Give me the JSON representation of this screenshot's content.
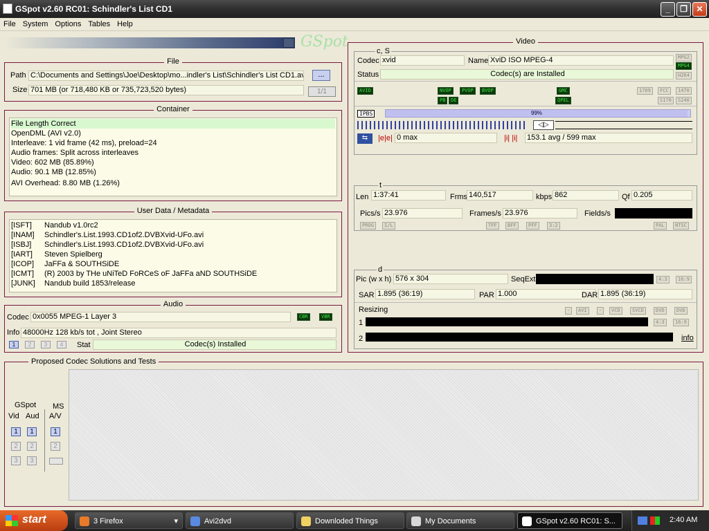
{
  "window": {
    "title": "GSpot v2.60 RC01: Schindler's List CD1"
  },
  "menu": [
    "File",
    "System",
    "Options",
    "Tables",
    "Help"
  ],
  "file": {
    "title": "File",
    "path_label": "Path",
    "path_value": "C:\\Documents and Settings\\Joe\\Desktop\\mo...indler's List\\Schindler's List CD1.avi",
    "browse_label": "...",
    "size_label": "Size",
    "size_value": "701 MB (or 718,480 KB or 735,723,520 bytes)",
    "page_counter": "1/1"
  },
  "container": {
    "title": "Container",
    "lines": [
      "File Length Correct",
      "OpenDML (AVI v2.0)",
      "Interleave: 1 vid frame (42 ms), preload=24",
      "Audio frames: Split across interleaves",
      "Video: 602 MB (85.89%)",
      "Audio: 90.1 MB (12.85%)",
      "AVI Overhead: 8.80 MB (1.26%)"
    ]
  },
  "userdata": {
    "title": "User Data / Metadata",
    "rows": [
      {
        "key": "[ISFT]",
        "val": "Nandub v1.0rc2"
      },
      {
        "key": "[INAM]",
        "val": "Schindler's.List.1993.CD1of2.DVBXvid-UFo.avi"
      },
      {
        "key": "[ISBJ]",
        "val": "Schindler's.List.1993.CD1of2.DVBXvid-UFo.avi"
      },
      {
        "key": "[IART]",
        "val": "Steven Spielberg"
      },
      {
        "key": "[ICOP]",
        "val": "JaFFa & SOUTHSiDE"
      },
      {
        "key": "[ICMT]",
        "val": "(R) 2003 by THe uNiTeD FoRCeS oF JaFFa aND SOUTHSiDE"
      },
      {
        "key": "[JUNK]",
        "val": "Nandub build 1853/release"
      }
    ]
  },
  "audio": {
    "title": "Audio",
    "codec_label": "Codec",
    "codec_value": "0x0055  MPEG-1 Layer 3",
    "cbr": "CBR",
    "vbr": "VBR",
    "info_label": "Info",
    "info_value": "48000Hz  128 kb/s tot , Joint Stereo",
    "stat_label": "Stat",
    "stat_value": "Codec(s) Installed",
    "tracks": [
      "1",
      "2",
      "3",
      "4"
    ]
  },
  "video": {
    "title": "Video",
    "cs_title": "c, S",
    "codec_label": "Codec",
    "codec_value": "xvid",
    "name_label": "Name",
    "name_value": "XviD ISO MPEG-4",
    "status_label": "Status",
    "status_value": "Codec(s) are Installed",
    "tags_right": [
      "MPG2",
      "MPG4",
      "H264"
    ],
    "flags": [
      "AVID",
      "NVOP",
      "PVOP",
      "BVOP",
      "PB",
      "DE",
      "GMC",
      "QPEL",
      "1709",
      "FCC",
      "1470",
      "S170",
      "S240"
    ],
    "ipb": "IPBS",
    "progress_pct": "99%",
    "progress_value": 0.99,
    "eb_label": "0 max",
    "ii_label": "153.1 avg / 599 max",
    "t_title": "t",
    "len_label": "Len",
    "len_value": "1:37:41",
    "frms_label": "Frms",
    "frms_value": "140,517",
    "kbps_label": "kbps",
    "kbps_value": "862",
    "qf_label": "Qf",
    "qf_value": "0.205",
    "pics_label": "Pics/s",
    "pics_value": "23.976",
    "frames_label": "Frames/s",
    "frames_value": "23.976",
    "fields_label": "Fields/s",
    "t_tags": [
      "PROG",
      "I/L",
      "TFF",
      "BFF",
      "PFF",
      "3:2",
      "PAL",
      "NTSC"
    ],
    "d_title": "d",
    "pic_label": "Pic (w x h)",
    "pic_value": "576 x 304",
    "seqext_label": "SeqExt",
    "ratio_tags": [
      "4:3",
      "16:9"
    ],
    "sar_label": "SAR",
    "sar_value": "1.895 (36:19)",
    "par_label": "PAR",
    "par_value": "1.000",
    "dar_label": "DAR",
    "dar_value": "1.895 (36:19)",
    "resizing_label": "Resizing",
    "resize_tags": [
      "-",
      "AVI",
      "-",
      "VCD",
      "SVCD",
      "DVD",
      "DVD"
    ],
    "row1": "1",
    "row2": "2",
    "info_link": "info"
  },
  "proposed": {
    "title": "Proposed Codec Solutions and Tests",
    "gspot_label": "GSpot",
    "vid_label": "Vid",
    "aud_label": "Aud",
    "ms_label": "MS",
    "av_label": "A/V",
    "buttons": [
      "1",
      "2",
      "3"
    ]
  },
  "taskbar": {
    "start": "start",
    "items": [
      "3 Firefox",
      "Avi2dvd",
      "Downloded Things",
      "My Documents",
      "GSpot v2.60 RC01: S..."
    ],
    "clock": "2:40 AM"
  }
}
